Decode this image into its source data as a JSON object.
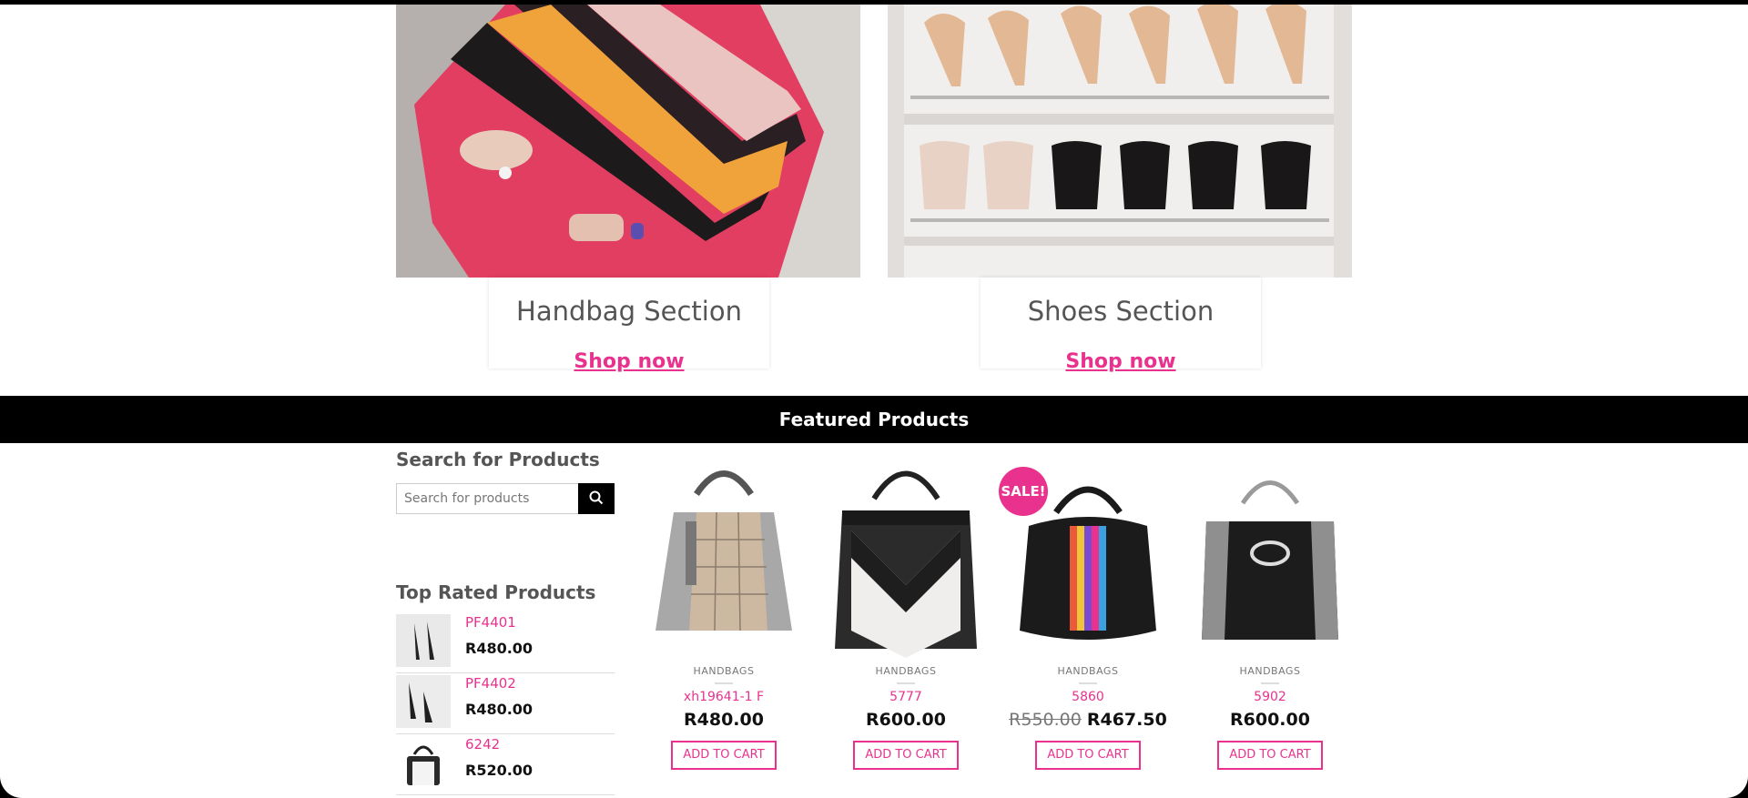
{
  "categories": [
    {
      "title": "Handbag Section",
      "link": "Shop now"
    },
    {
      "title": "Shoes Section",
      "link": "Shop now"
    }
  ],
  "featured": {
    "title": "Featured Products"
  },
  "sidebar": {
    "search_title": "Search for Products",
    "search_placeholder": "Search for products",
    "top_rated_title": "Top Rated Products",
    "top_rated": [
      {
        "name": "PF4401",
        "price": "R480.00"
      },
      {
        "name": "PF4402",
        "price": "R480.00"
      },
      {
        "name": "6242",
        "price": "R520.00"
      }
    ]
  },
  "products": [
    {
      "category": "HANDBAGS",
      "name": "xh19641-1 F",
      "price": "R480.00",
      "old_price": "",
      "button": "ADD TO CART"
    },
    {
      "category": "HANDBAGS",
      "name": "5777",
      "price": "R600.00",
      "old_price": "",
      "button": "ADD TO CART"
    },
    {
      "category": "HANDBAGS",
      "name": "5860",
      "price": "R467.50",
      "old_price": "R550.00",
      "button": "ADD TO CART",
      "badge": "SALE!"
    },
    {
      "category": "HANDBAGS",
      "name": "5902",
      "price": "R600.00",
      "old_price": "",
      "button": "ADD TO CART"
    }
  ],
  "colors": {
    "accent": "#e8328d",
    "bar": "#000000"
  }
}
